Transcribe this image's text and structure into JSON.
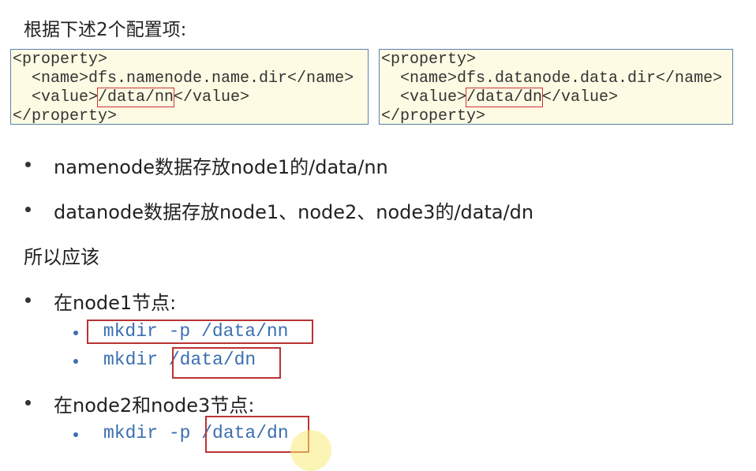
{
  "title": "根据下述2个配置项:",
  "config_left": {
    "open": "<property>",
    "name_line": "  <name>dfs.namenode.name.dir</name>",
    "value_open": "  <value>",
    "value": "/data/nn",
    "value_close": "</value>",
    "close": "</property>"
  },
  "config_right": {
    "open": "<property>",
    "name_line": "  <name>dfs.datanode.data.dir</name>",
    "value_open": "  <value>",
    "value": "/data/dn",
    "value_close": "</value>",
    "close": "</property>"
  },
  "bullets": [
    "namenode数据存放node1的/data/nn",
    "datanode数据存放node1、node2、node3的/data/dn"
  ],
  "conclusion": "所以应该",
  "node1": {
    "label": "在node1节点:",
    "commands": [
      " mkdir -p /data/nn",
      "mkdir /data/dn"
    ]
  },
  "node23": {
    "label": "在node2和node3节点:",
    "commands": [
      "mkdir -p /data/dn"
    ]
  },
  "colors": {
    "code_bg": "#fdfbe3",
    "command": "#3a6fb0",
    "highlight_box": "#b33333"
  }
}
